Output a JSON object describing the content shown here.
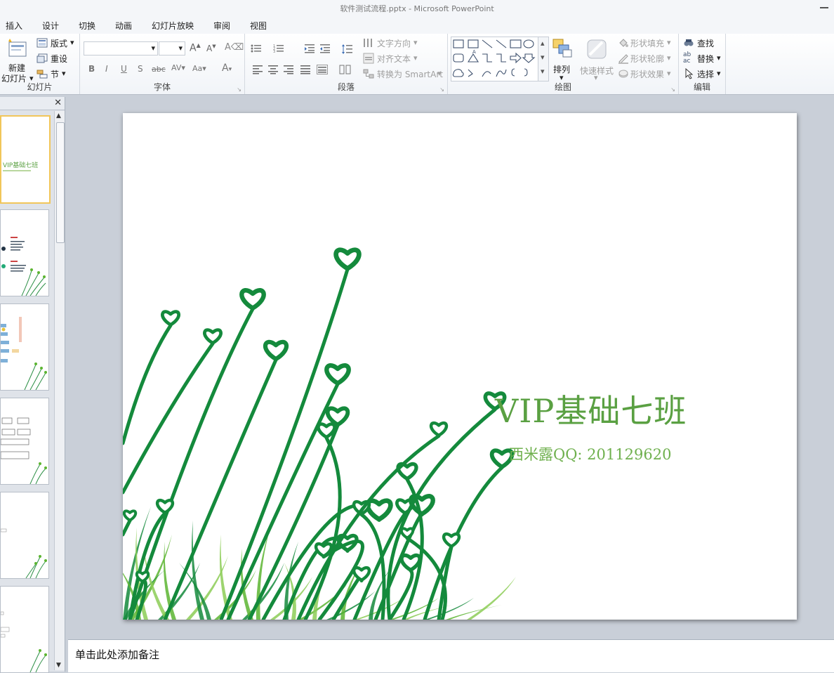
{
  "window": {
    "title": "软件测试流程.pptx - Microsoft PowerPoint"
  },
  "tabs": [
    "插入",
    "设计",
    "切换",
    "动画",
    "幻灯片放映",
    "审阅",
    "视图"
  ],
  "ribbon": {
    "slides_group": {
      "label": "幻灯片",
      "new_slide": "新建",
      "new_slide2": "幻灯片",
      "layout": "版式",
      "reset": "重设",
      "section": "节"
    },
    "font_group": {
      "label": "字体",
      "font_name": "",
      "font_size": ""
    },
    "paragraph_group": {
      "label": "段落",
      "text_direction": "文字方向",
      "align_text": "对齐文本",
      "convert_smartart": "转换为 SmartArt"
    },
    "drawing_group": {
      "label": "绘图",
      "arrange": "排列",
      "quick_styles": "快速样式",
      "shape_fill": "形状填充",
      "shape_outline": "形状轮廓",
      "shape_effects": "形状效果"
    },
    "editing_group": {
      "label": "编辑",
      "find": "查找",
      "replace": "替换",
      "select": "选择"
    }
  },
  "slide": {
    "title": "VIP基础七班",
    "subtitle": "西米露QQ: 201129620"
  },
  "thumbnail": {
    "title": "VIP基础七班"
  },
  "notes": {
    "placeholder": "单击此处添加备注"
  },
  "colors": {
    "accent_green": "#5aa042",
    "stem_green": "#148a3c",
    "grass_green": "#5cb531"
  }
}
